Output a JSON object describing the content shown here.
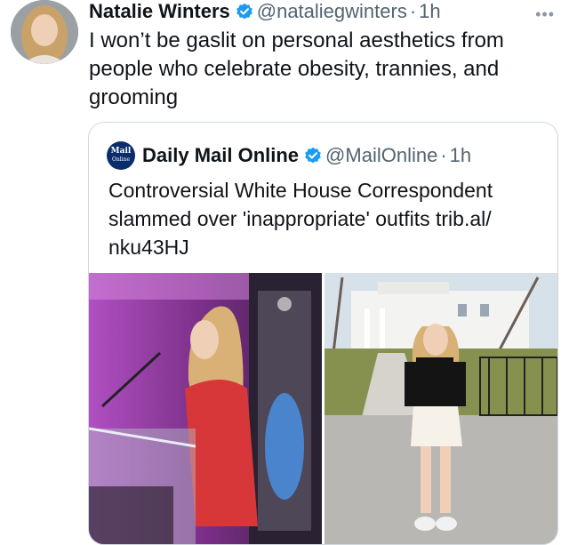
{
  "tweet": {
    "author_name": "Natalie Winters",
    "handle": "@nataliegwinters",
    "separator": "·",
    "time": "1h",
    "more_icon": "more-horizontal-icon",
    "text": "I won’t be gaslit on personal aesthetics from people who celebrate obesity, trannies, and grooming"
  },
  "quoted": {
    "logo_line1": "Mail",
    "logo_line2": "Online",
    "author_name": "Daily Mail Online",
    "handle": "@MailOnline",
    "separator": "·",
    "time": "1h",
    "text": "Controversial White House Correspondent slammed over 'inappropriate' outfits trib.al/ nku43HJ"
  },
  "colors": {
    "verified": "#1d9bf0",
    "secondary_text": "#536471",
    "border": "#cfd9de"
  }
}
